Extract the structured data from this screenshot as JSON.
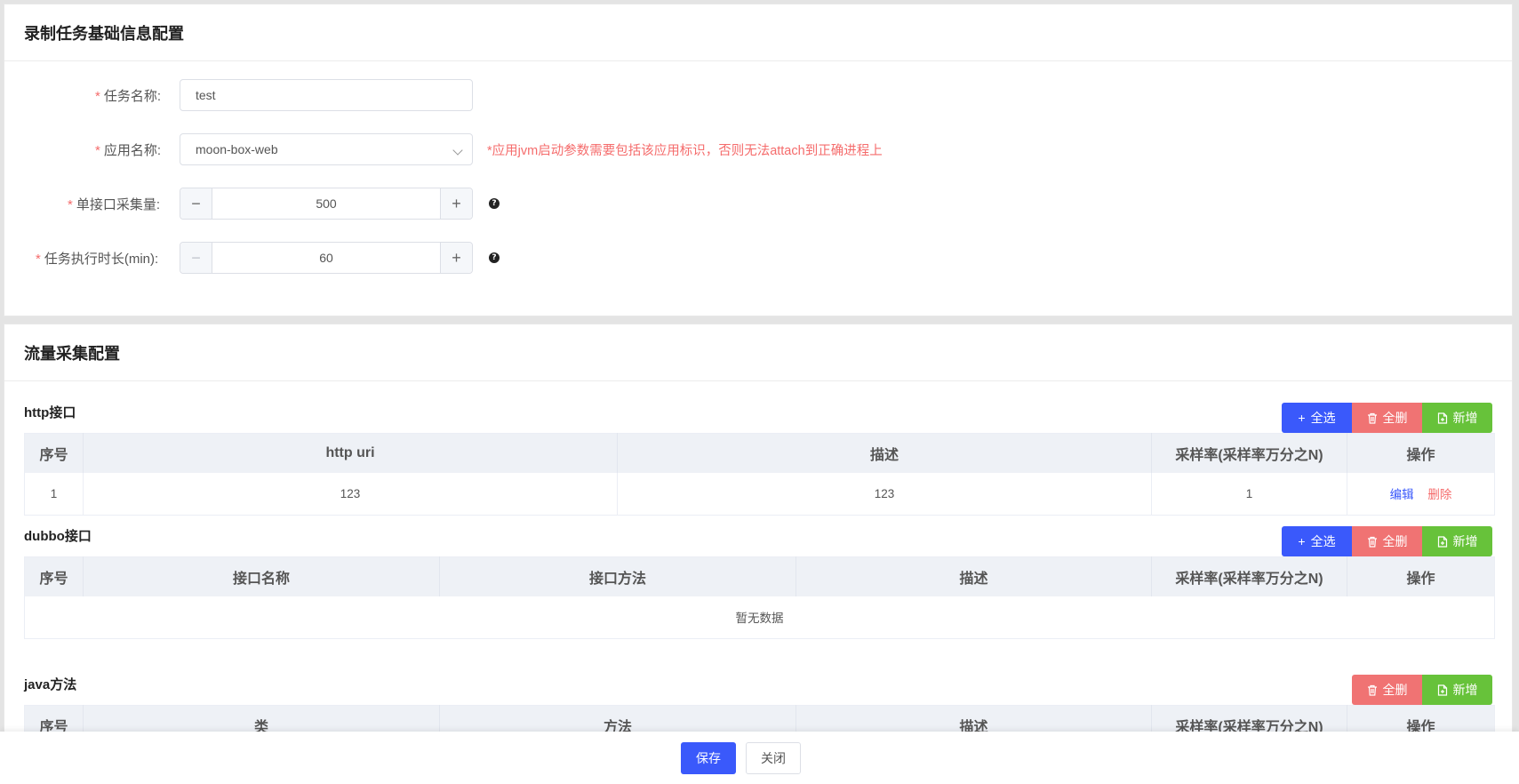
{
  "basic": {
    "title": "录制任务基础信息配置",
    "task_name": {
      "label": "任务名称:",
      "value": "test"
    },
    "app_name": {
      "label": "应用名称:",
      "value": "moon-box-web",
      "hint": "*应用jvm启动参数需要包括该应用标识，否则无法attach到正确进程上"
    },
    "sample_count": {
      "label": "单接口采集量:",
      "value": "500"
    },
    "duration": {
      "label": "任务执行时长(min):",
      "value": "60"
    }
  },
  "traffic": {
    "title": "流量采集配置",
    "buttons": {
      "select_all": "全选",
      "delete_all": "全删",
      "add": "新增"
    },
    "http": {
      "title": "http接口",
      "columns": [
        "序号",
        "http uri",
        "描述",
        "采样率(采样率万分之N)",
        "操作"
      ],
      "rows": [
        {
          "index": "1",
          "uri": "123",
          "desc": "123",
          "rate": "1",
          "edit": "编辑",
          "delete": "删除"
        }
      ]
    },
    "dubbo": {
      "title": "dubbo接口",
      "columns": [
        "序号",
        "接口名称",
        "接口方法",
        "描述",
        "采样率(采样率万分之N)",
        "操作"
      ],
      "empty": "暂无数据"
    },
    "java": {
      "title": "java方法",
      "columns": [
        "序号",
        "类",
        "方法",
        "描述",
        "采样率(采样率万分之N)",
        "操作"
      ]
    }
  },
  "footer": {
    "save": "保存",
    "close": "关闭"
  },
  "colors": {
    "primary": "#3a59fb",
    "danger": "#f07373",
    "success": "#67c23a",
    "required": "#f56c6c"
  }
}
